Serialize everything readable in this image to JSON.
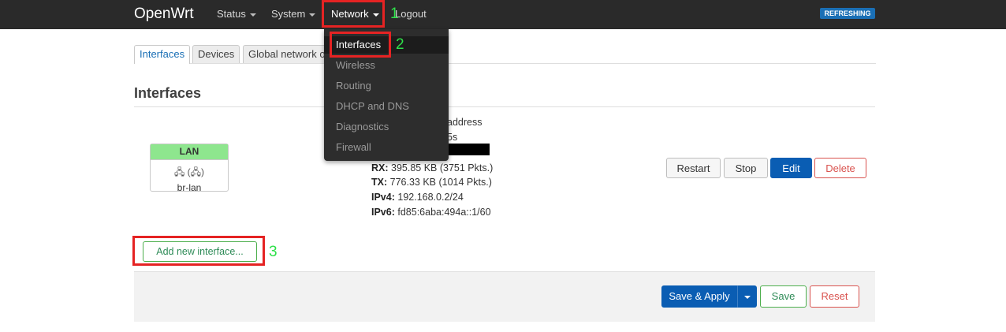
{
  "header": {
    "brand": "OpenWrt",
    "menu": [
      "Status",
      "System",
      "Network",
      "Logout"
    ],
    "badge": "REFRESHING"
  },
  "dropdown": {
    "items": [
      "Interfaces",
      "Wireless",
      "Routing",
      "DHCP and DNS",
      "Diagnostics",
      "Firewall"
    ]
  },
  "tabs": [
    "Interfaces",
    "Devices",
    "Global network o"
  ],
  "section_title": "Interfaces",
  "interface": {
    "name": "LAN",
    "icons": "🖧 (🖧)",
    "device": "br-lan",
    "partial_line1": "address",
    "partial_line2": "5s",
    "rx_label": "RX:",
    "rx_value": "395.85 KB (3751 Pkts.)",
    "tx_label": "TX:",
    "tx_value": "776.33 KB (1014 Pkts.)",
    "ipv4_label": "IPv4:",
    "ipv4_value": "192.168.0.2/24",
    "ipv6_label": "IPv6:",
    "ipv6_value": "fd85:6aba:494a::1/60"
  },
  "row_buttons": {
    "restart": "Restart",
    "stop": "Stop",
    "edit": "Edit",
    "delete": "Delete"
  },
  "add_new_label": "Add new interface...",
  "footer": {
    "save_apply": "Save & Apply",
    "save": "Save",
    "reset": "Reset"
  },
  "annotations": [
    "1",
    "2",
    "3"
  ],
  "colors": {
    "annotation_box": "#e52323",
    "annotation_number": "#2ee04a",
    "primary": "#0a5db3",
    "interface_header": "#8ee68e"
  }
}
